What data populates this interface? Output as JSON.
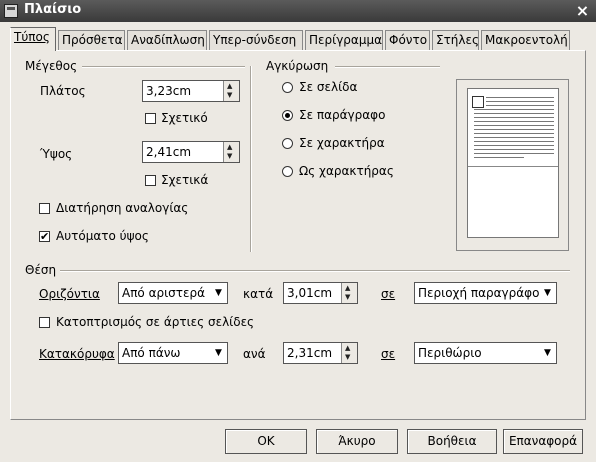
{
  "window": {
    "title": "Πλαίσιο",
    "close_icon": "close-icon"
  },
  "tabs": [
    {
      "label": "Τύπος",
      "active": true
    },
    {
      "label": "Πρόσθετα"
    },
    {
      "label": "Αναδίπλωση"
    },
    {
      "label": "Υπερ-σύνδεση"
    },
    {
      "label": "Περίγραμμα"
    },
    {
      "label": "Φόντο"
    },
    {
      "label": "Στήλες"
    },
    {
      "label": "Μακροεντολή"
    }
  ],
  "size": {
    "legend": "Μέγεθος",
    "width_label": "Πλάτος",
    "width_value": "3,23cm",
    "width_relative": "Σχετικό",
    "height_label": "Ύψος",
    "height_value": "2,41cm",
    "height_relative": "Σχετικά",
    "keep_ratio": "Διατήρηση αναλογίας",
    "auto_height": "Αυτόματο ύψος"
  },
  "anchor": {
    "legend": "Αγκύρωση",
    "options": [
      "Σε σελίδα",
      "Σε παράγραφο",
      "Σε χαρακτήρα",
      "Ως χαρακτήρας"
    ],
    "selected": 1
  },
  "position": {
    "legend": "Θέση",
    "horizontal_label": "Οριζόντια",
    "horizontal_value": "Από αριστερά",
    "by_label": "κατά",
    "horizontal_by": "3,01cm",
    "to_label": "σε",
    "horizontal_to": "Περιοχή παραγράφου",
    "mirror": "Κατοπτρισμός σε άρτιες σελίδες",
    "vertical_label": "Κατακόρυφα",
    "vertical_value": "Από πάνω",
    "by_label2": "ανά",
    "vertical_by": "2,31cm",
    "to_label2": "σε",
    "vertical_to": "Περιθώριο"
  },
  "buttons": {
    "ok": "OK",
    "cancel": "Άκυρο",
    "help": "Βοήθεια",
    "reset": "Επαναφορά"
  },
  "icons": {
    "spin_up": "▲",
    "spin_down": "▼",
    "dropdown": "▼",
    "check": "✔"
  }
}
